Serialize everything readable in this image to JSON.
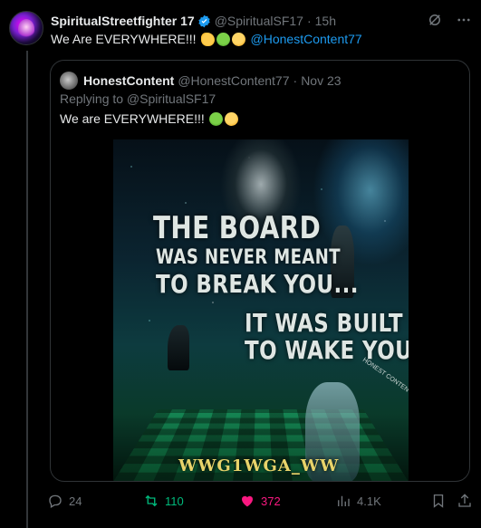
{
  "tweet": {
    "display_name": "SpiritualStreetfighter 17",
    "handle": "@SpiritualSF17",
    "time": "15h",
    "text": "We Are EVERYWHERE!!!",
    "emojis": [
      "flexed-biceps",
      "frog",
      "shushing-face"
    ],
    "mention": "@HonestContent77"
  },
  "quote": {
    "display_name": "HonestContent",
    "handle": "@HonestContent77",
    "date": "Nov 23",
    "replying_to": "Replying to @SpiritualSF17",
    "text": "We are EVERYWHERE!!!",
    "emojis": [
      "frog",
      "shushing-face"
    ],
    "poster": {
      "line1": "THE BOARD",
      "line2": "WAS NEVER MEANT",
      "line3": "TO BREAK YOU...",
      "line4": "IT WAS BUILT",
      "line5": "TO WAKE YOU.",
      "watermark": "HONEST CONTENT",
      "footer": "WWG1WGA_WW"
    }
  },
  "actions": {
    "replies": "24",
    "reposts": "110",
    "likes": "372",
    "views": "4.1K"
  },
  "colors": {
    "background": "#000000",
    "text_primary": "#e7e9ea",
    "text_secondary": "#71767b",
    "link": "#1d9bf0",
    "repost_active": "#00ba7c",
    "like_active": "#f91880",
    "border": "#2f3336"
  }
}
